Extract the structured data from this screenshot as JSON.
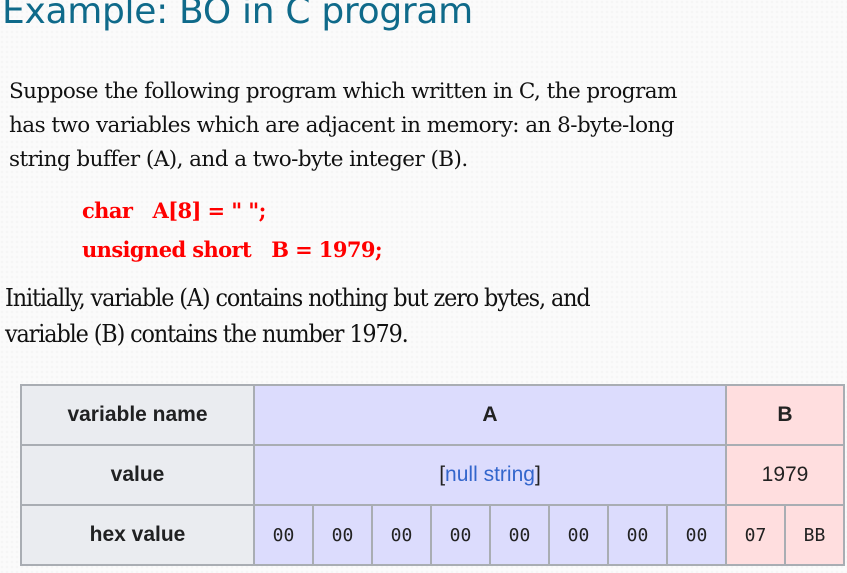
{
  "slide": {
    "title": "Example: BO in C program",
    "intro_lines": [
      "Suppose the following program which written in C, the program",
      "has two variables which are adjacent in memory: an 8-byte-long",
      "string buffer (A), and a two-byte integer (B)."
    ],
    "code_lines": [
      "char   A[8] = \" \";",
      "unsigned short   B = 1979;"
    ],
    "explanation_lines": [
      "Initially, variable (A) contains nothing but zero bytes, and",
      "variable (B) contains the number 1979."
    ]
  },
  "colors": {
    "title": "#0f6a8a",
    "code": "#ff0000",
    "variable_a_bg": "#dcdcfd",
    "variable_b_bg": "#ffdedf",
    "row_header_bg": "#eaecf0",
    "link": "#3366cc"
  },
  "memory_table": {
    "row_headers": [
      "variable name",
      "value",
      "hex value"
    ],
    "variable_a": {
      "name": "A",
      "value_open": "[",
      "value_link": "null string",
      "value_close": "]",
      "hex": [
        "00",
        "00",
        "00",
        "00",
        "00",
        "00",
        "00",
        "00"
      ]
    },
    "variable_b": {
      "name": "B",
      "value": "1979",
      "hex": [
        "07",
        "BB"
      ]
    }
  }
}
